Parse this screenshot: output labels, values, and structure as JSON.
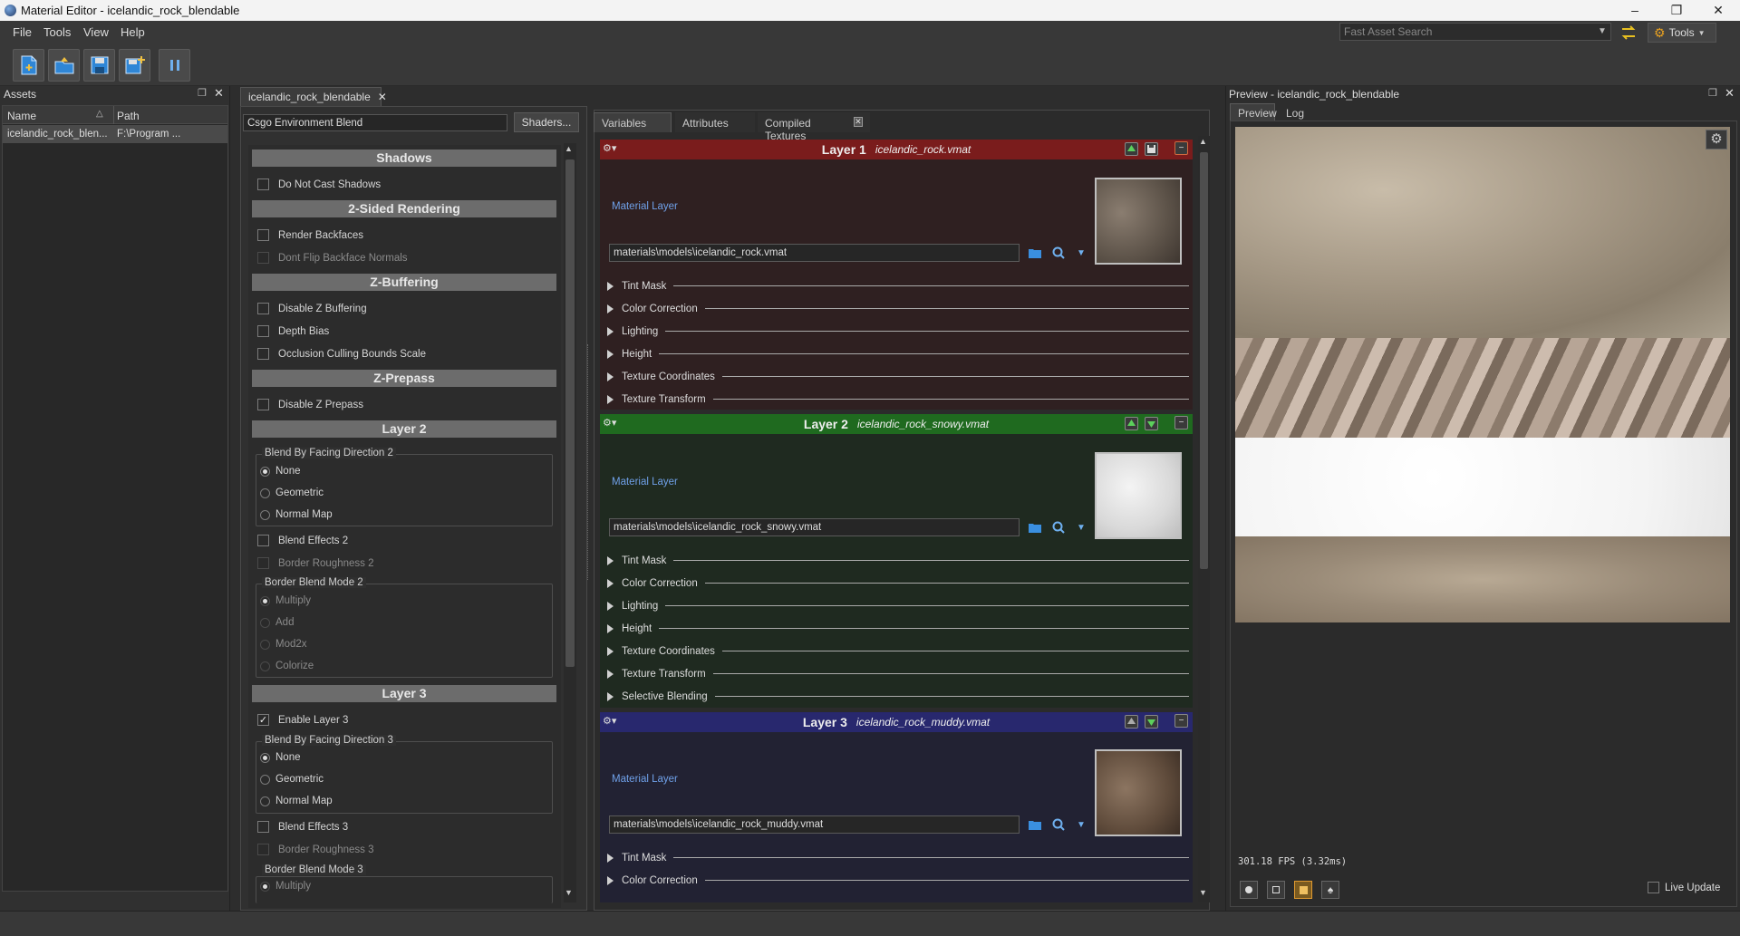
{
  "window": {
    "title": "Material Editor - icelandic_rock_blendable"
  },
  "menu": [
    "File",
    "Tools",
    "View",
    "Help"
  ],
  "search": {
    "placeholder": "Fast Asset Search"
  },
  "tools_label": "Tools",
  "assets": {
    "title": "Assets",
    "col_name": "Name",
    "col_path": "Path",
    "row_name": "icelandic_rock_blen...",
    "row_path": "F:\\Program ..."
  },
  "material_tab": "icelandic_rock_blendable",
  "shader": {
    "name": "Csgo Environment Blend",
    "button": "Shaders..."
  },
  "props": {
    "shadows": "Shadows",
    "do_not_cast": "Do Not Cast Shadows",
    "two_sided": "2-Sided Rendering",
    "render_backfaces": "Render Backfaces",
    "dont_flip": "Dont Flip Backface Normals",
    "zbuffering": "Z-Buffering",
    "disable_z": "Disable Z Buffering",
    "depth_bias": "Depth Bias",
    "occlusion": "Occlusion Culling Bounds Scale",
    "zprepass": "Z-Prepass",
    "disable_zprepass": "Disable Z Prepass",
    "layer2": "Layer 2",
    "blend_facing2": "Blend By Facing Direction 2",
    "none": "None",
    "geometric": "Geometric",
    "normal_map": "Normal Map",
    "blend_effects2": "Blend Effects 2",
    "border_rough2": "Border Roughness 2",
    "border_mode2": "Border Blend Mode 2",
    "multiply": "Multiply",
    "add": "Add",
    "mod2x": "Mod2x",
    "colorize": "Colorize",
    "layer3": "Layer 3",
    "enable_layer3": "Enable Layer 3",
    "blend_facing3": "Blend By Facing Direction 3",
    "blend_effects3": "Blend Effects 3",
    "border_rough3": "Border Roughness 3",
    "border_mode3": "Border Blend Mode 3"
  },
  "tabs": {
    "variables": "Variables",
    "attributes": "Attributes",
    "compiled": "Compiled Textures"
  },
  "layers": [
    {
      "name": "Layer 1",
      "file": "icelandic_rock.vmat",
      "label": "Material Layer",
      "path": "materials\\models\\icelandic_rock.vmat",
      "color": "#7a1c1c",
      "body": "#2f2021",
      "subs": [
        "Tint Mask",
        "Color Correction",
        "Lighting",
        "Height",
        "Texture Coordinates",
        "Texture Transform"
      ]
    },
    {
      "name": "Layer 2",
      "file": "icelandic_rock_snowy.vmat",
      "label": "Material Layer",
      "path": "materials\\models\\icelandic_rock_snowy.vmat",
      "color": "#1f6a1f",
      "body": "#1f2a20",
      "subs": [
        "Tint Mask",
        "Color Correction",
        "Lighting",
        "Height",
        "Texture Coordinates",
        "Texture Transform",
        "Selective Blending"
      ]
    },
    {
      "name": "Layer 3",
      "file": "icelandic_rock_muddy.vmat",
      "label": "Material Layer",
      "path": "materials\\models\\icelandic_rock_muddy.vmat",
      "color": "#28286e",
      "body": "#222233",
      "subs": [
        "Tint Mask",
        "Color Correction"
      ]
    }
  ],
  "preview": {
    "title": "Preview - icelandic_rock_blendable",
    "tab_preview": "Preview",
    "tab_log": "Log",
    "fps": "301.18 FPS (3.32ms)",
    "live_update": "Live Update"
  }
}
